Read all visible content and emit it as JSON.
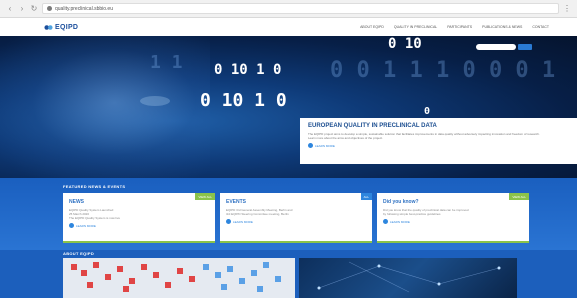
{
  "browser": {
    "url": "quality.preclinical.sbbio.eu",
    "back_icon": "back-arrow-icon",
    "forward_icon": "forward-arrow-icon",
    "reload_icon": "reload-icon",
    "menu_icon": "menu-icon"
  },
  "header": {
    "logo_text": "EQIPD",
    "nav": [
      "ABOUT EQIPD",
      "QUALITY IN PRECLINICAL",
      "PARTICIPANTS",
      "PUBLICATIONS & NEWS",
      "CONTACT"
    ]
  },
  "hero": {
    "binary_top": "0   10",
    "binary_mid": "0  10 1  0",
    "binary_low": "0  10  1  0",
    "binary_single": "0",
    "card_title": "EUROPEAN QUALITY IN PRECLINICAL DATA",
    "card_text_1": "The EQIPD project aims to develop a simple, sustainable solution that facilitates improvements in data quality without adversely impacting innovation and freedom of research.",
    "card_text_2": "Learn more about the aims and objectives of the project.",
    "read_more": "LEARN MORE"
  },
  "featured": {
    "title": "FEATURED NEWS & EVENTS",
    "cards": [
      {
        "title": "NEWS",
        "badge": "VIEW ALL",
        "line1": "EQIPD Quality System Launched",
        "line2": "25 March 2020",
        "line3": "The EQIPD Quality System is now live",
        "link": "LEARN MORE"
      },
      {
        "title": "EVENTS",
        "badge": "ALL",
        "line1": "EQIPD 3rd General Assembly Meeting, Berlin and",
        "line2": "3rd EQIPD Steering Committee meeting, Berlin",
        "line3": "",
        "link": "LEARN MORE"
      },
      {
        "title": "Did you know?",
        "badge": "VIEW ALL",
        "line1": "Did you know that the quality of preclinical data can be improved",
        "line2": "by following simple best-practice guidelines",
        "line3": "",
        "link": "LEARN MORE"
      }
    ]
  },
  "about": {
    "title": "ABOUT EQIPD"
  },
  "colors": {
    "hero_dark": "#071f47",
    "brand_blue": "#1d4f91",
    "featured_blue": "#1a5fbf",
    "accent_green": "#8bc34a",
    "accent_blue": "#2e86de"
  }
}
